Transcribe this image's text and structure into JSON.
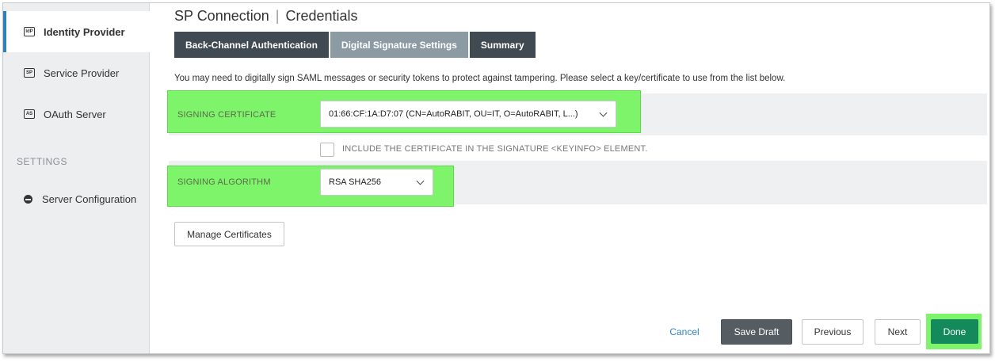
{
  "sidebar": {
    "items": [
      {
        "label": "Identity Provider",
        "icon": "IdP"
      },
      {
        "label": "Service Provider",
        "icon": "SP"
      },
      {
        "label": "OAuth Server",
        "icon": "AS"
      }
    ],
    "settings_heading": "SETTINGS",
    "settings_items": [
      {
        "label": "Server Configuration",
        "icon": "server-icon"
      }
    ]
  },
  "header": {
    "title_left": "SP Connection",
    "title_right": "Credentials"
  },
  "tabs": [
    {
      "label": "Back-Channel Authentication"
    },
    {
      "label": "Digital Signature Settings"
    },
    {
      "label": "Summary"
    }
  ],
  "main": {
    "intro": "You may need to digitally sign SAML messages or security tokens to protect against tampering. Please select a key/certificate to use from the list below.",
    "signing_certificate": {
      "label": "SIGNING CERTIFICATE",
      "value": "01:66:CF:1A:D7:07 (CN=AutoRABIT, OU=IT, O=AutoRABIT, L...)"
    },
    "include_cert": {
      "label": "INCLUDE THE CERTIFICATE IN THE SIGNATURE <KEYINFO> ELEMENT.",
      "checked": false
    },
    "signing_algorithm": {
      "label": "SIGNING ALGORITHM",
      "value": "RSA SHA256"
    },
    "manage_certificates": "Manage Certificates"
  },
  "footer": {
    "cancel": "Cancel",
    "save_draft": "Save Draft",
    "previous": "Previous",
    "next": "Next",
    "done": "Done"
  },
  "colors": {
    "accent": "#2f7fb8",
    "highlight": "#7df46a",
    "done": "#148a5c"
  }
}
